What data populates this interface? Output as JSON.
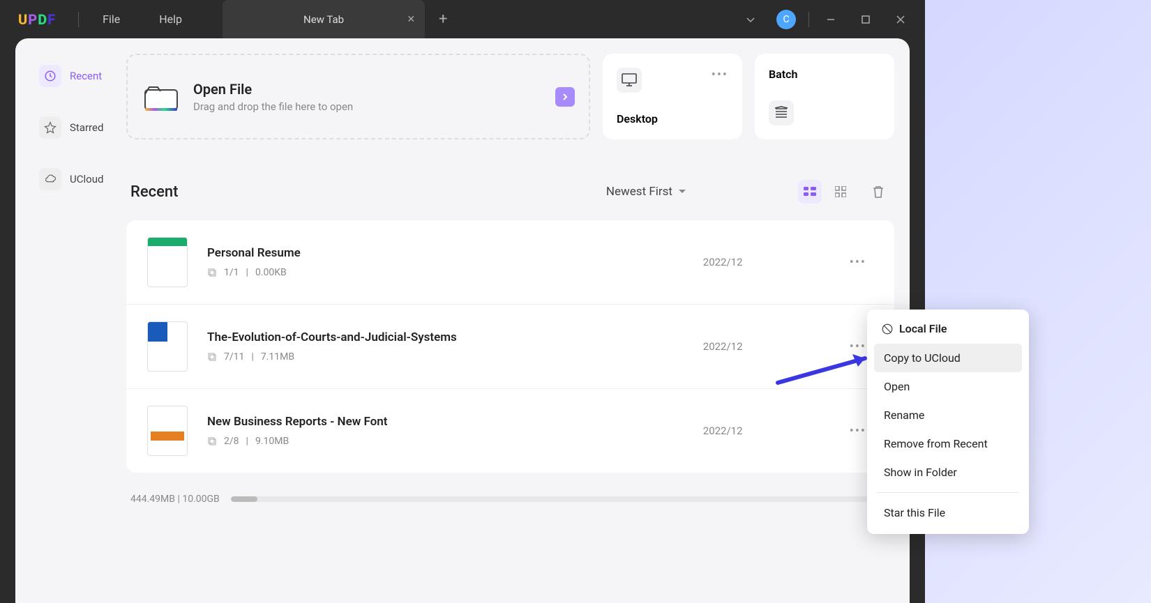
{
  "app": {
    "name": "UPDF"
  },
  "menus": {
    "file": "File",
    "help": "Help"
  },
  "tab": {
    "title": "New Tab"
  },
  "avatar": {
    "initial": "C"
  },
  "sidebar": {
    "items": [
      {
        "label": "Recent",
        "active": true
      },
      {
        "label": "Starred",
        "active": false
      },
      {
        "label": "UCloud",
        "active": false
      }
    ]
  },
  "open_file": {
    "title": "Open File",
    "subtitle": "Drag and drop the file here to open"
  },
  "desktop_card": {
    "label": "Desktop"
  },
  "batch_card": {
    "label": "Batch"
  },
  "recent": {
    "heading": "Recent",
    "sort": "Newest First",
    "files": [
      {
        "name": "Personal Resume",
        "pages": "1/1",
        "size": "0.00KB",
        "date": "2022/12"
      },
      {
        "name": "The-Evolution-of-Courts-and-Judicial-Systems",
        "pages": "7/11",
        "size": "7.11MB",
        "date": "2022/12"
      },
      {
        "name": "New Business Reports - New Font",
        "pages": "2/8",
        "size": "9.10MB",
        "date": "2022/12"
      }
    ]
  },
  "storage": {
    "used": "444.49MB",
    "total": "10.00GB"
  },
  "context_menu": {
    "header": "Local File",
    "items": [
      "Copy to UCloud",
      "Open",
      "Rename",
      "Remove from Recent",
      "Show in Folder"
    ],
    "star_item": "Star this File"
  }
}
